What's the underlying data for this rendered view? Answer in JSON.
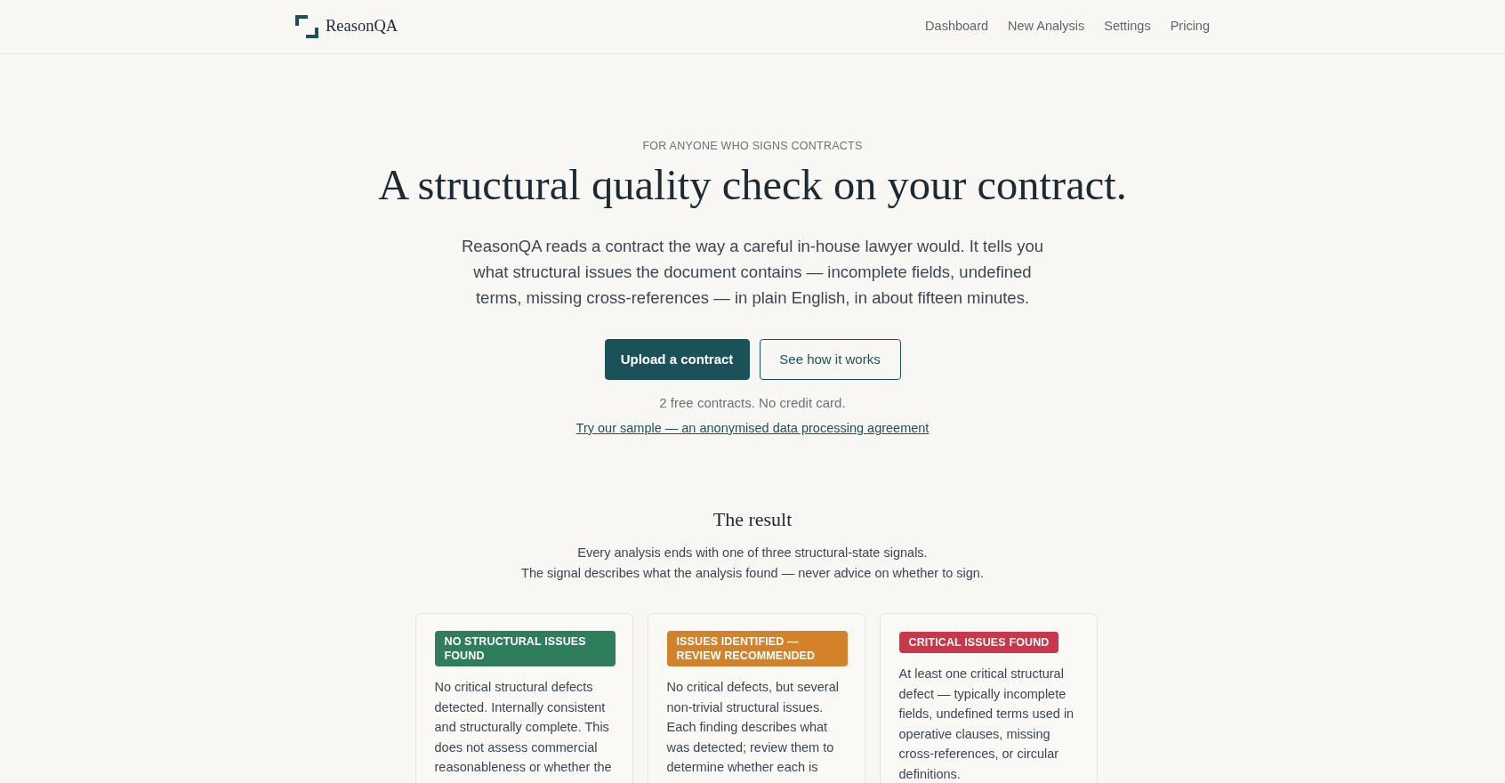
{
  "header": {
    "logo": "ReasonQA",
    "nav": [
      {
        "label": "Dashboard"
      },
      {
        "label": "New Analysis"
      },
      {
        "label": "Settings"
      },
      {
        "label": "Pricing"
      }
    ]
  },
  "hero": {
    "eyebrow": "FOR ANYONE WHO SIGNS CONTRACTS",
    "title": "A structural quality check on your contract.",
    "lead": "ReasonQA reads a contract the way a careful in-house lawyer would. It tells you what structural issues the document contains — incomplete fields, undefined terms, missing cross-references — in plain English, in about fifteen minutes.",
    "buttons": [
      {
        "label": "Upload a contract",
        "kind": "primary"
      },
      {
        "label": "See how it works",
        "kind": "outline"
      }
    ],
    "note": "2 free contracts. No credit card.",
    "sample_link": "Try our sample — an anonymised data processing agreement"
  },
  "result": {
    "title": "The result",
    "subtitle": [
      "Every analysis ends with one of three structural-state signals.",
      "The signal describes what the analysis found — never advice on whether to sign."
    ],
    "signals": [
      {
        "badge": "NO STRUCTURAL ISSUES FOUND",
        "color": "#2e7d5b",
        "text": "No critical structural defects detected. Internally consistent and structurally complete. This does not assess commercial reasonableness or whether the"
      },
      {
        "badge": "ISSUES IDENTIFIED — REVIEW RECOMMENDED",
        "color": "#d4822a",
        "text": "No critical defects, but several non-trivial structural issues. Each finding describes what was detected; review them to determine whether each is"
      },
      {
        "badge": "CRITICAL ISSUES FOUND",
        "color": "#c8374a",
        "text": "At least one critical structural defect — typically incomplete fields, undefined terms used in operative clauses, missing cross-references, or circular definitions."
      }
    ]
  }
}
